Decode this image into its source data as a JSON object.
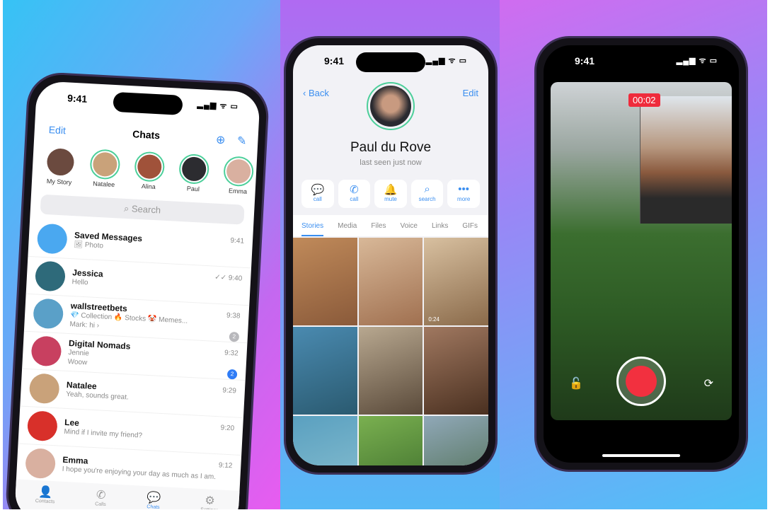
{
  "status": {
    "time": "9:41",
    "signal": "▂▄▆ ᯤ ▭"
  },
  "chats": {
    "edit": "Edit",
    "title": "Chats",
    "new_story_icon": "plus-circle-icon",
    "compose_icon": "compose-icon",
    "stories": [
      {
        "name": "My Story",
        "c": "#6b4a3f"
      },
      {
        "name": "Natalee",
        "c": "#c9a27a"
      },
      {
        "name": "Alina",
        "c": "#a0523a"
      },
      {
        "name": "Paul",
        "c": "#2c2c30"
      },
      {
        "name": "Emma",
        "c": "#d9b0a0"
      }
    ],
    "search_placeholder": "Search",
    "list": [
      {
        "name": "Saved Messages",
        "msg": "🖼 Photo",
        "time": "9:41",
        "c": "#4aa8f0"
      },
      {
        "name": "Jessica",
        "msg": "Hello",
        "time": "✓✓ 9:40",
        "c": "#2e6a7a"
      },
      {
        "name": "wallstreetbets",
        "msg": "💎 Collection 🔥 Stocks 🤡 Memes...",
        "msg2": "Mark: hi ›",
        "time": "9:38",
        "badge": "2",
        "badge_color": "#b8b8bc",
        "c": "#5aa0c8"
      },
      {
        "name": "Digital Nomads",
        "msg": "Jennie",
        "msg2": "Woow",
        "time": "9:32",
        "badge": "2",
        "badge_color": "#2f7cf6",
        "c": "#c84060"
      },
      {
        "name": "Natalee",
        "msg": "Yeah, sounds great.",
        "time": "9:29",
        "c": "#c9a27a"
      },
      {
        "name": "Lee",
        "msg": "Mind if I invite my friend?",
        "time": "9:20",
        "c": "#d8302a"
      },
      {
        "name": "Emma",
        "msg": "I hope you're enjoying your day as much as I am.",
        "time": "9:12",
        "c": "#d9b0a0"
      }
    ],
    "tabs": [
      {
        "label": "Contacts",
        "icon": "👤"
      },
      {
        "label": "Calls",
        "icon": "✆"
      },
      {
        "label": "Chats",
        "icon": "💬",
        "badge": "2"
      },
      {
        "label": "Settings",
        "icon": "⚙"
      }
    ]
  },
  "profile": {
    "back": "Back",
    "edit": "Edit",
    "name": "Paul du Rove",
    "status": "last seen just now",
    "actions": [
      {
        "label": "call",
        "icon": "💬"
      },
      {
        "label": "call",
        "icon": "✆"
      },
      {
        "label": "mute",
        "icon": "🔔"
      },
      {
        "label": "search",
        "icon": "⌕"
      },
      {
        "label": "more",
        "icon": "•••"
      }
    ],
    "tabs": [
      "Stories",
      "Media",
      "Files",
      "Voice",
      "Links",
      "GIFs"
    ],
    "media": [
      {
        "c1": "#c08a5a",
        "c2": "#8a5a3a"
      },
      {
        "c1": "#d8b898",
        "c2": "#a07050",
        "duration": ""
      },
      {
        "c1": "#d8c0a0",
        "c2": "#8a6a4a",
        "duration": "0:24"
      },
      {
        "c1": "#4a8ab0",
        "c2": "#2a5a70"
      },
      {
        "c1": "#b8a890",
        "c2": "#5a4a3a"
      },
      {
        "c1": "#a07860",
        "c2": "#4a3020"
      },
      {
        "c1": "#5aa0c0",
        "c2": "#8ac0d0"
      },
      {
        "c1": "#7ab050",
        "c2": "#3a6a2a"
      },
      {
        "c1": "#90a8b8",
        "c2": "#4a6a4a"
      }
    ]
  },
  "video": {
    "timer": "00:02",
    "lock_icon": "unlock-icon",
    "flip_icon": "flip-camera-icon"
  },
  "colors": {
    "accent": "#3a8ef0",
    "record": "#f2303f",
    "story_ring": "#4ccf9a"
  }
}
